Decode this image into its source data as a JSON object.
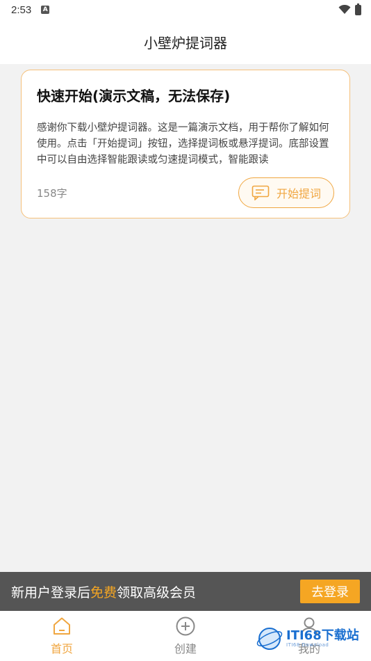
{
  "status_bar": {
    "time": "2:53",
    "notification_icon": "a-badge-icon"
  },
  "app_bar": {
    "title": "小壁炉提词器"
  },
  "script_card": {
    "title": "快速开始(演示文稿，无法保存)",
    "body": "感谢你下载小壁炉提词器。这是一篇演示文档，用于帮你了解如何使用。点击「开始提词」按钮，选择提词板或悬浮提词。底部设置中可以自由选择智能跟读或匀速提词模式，智能跟读",
    "char_count": "158字",
    "start_button_label": "开始提词"
  },
  "login_bar": {
    "promo_prefix": "新用户登录后",
    "promo_highlight": "免费",
    "promo_suffix": "领取高级会员",
    "login_button_label": "去登录"
  },
  "tabs": [
    {
      "label": "首页",
      "icon": "home-icon",
      "active": true
    },
    {
      "label": "创建",
      "icon": "plus-circle-icon",
      "active": false
    },
    {
      "label": "我的",
      "icon": "user-icon",
      "active": false
    }
  ],
  "watermark": {
    "text": "ITI68下载站",
    "sub": "ITI68 Download"
  },
  "colors": {
    "accent": "#f0a640",
    "login_bar_bg": "#555555",
    "login_button_bg": "#f5a623",
    "page_bg": "#f2f2f2"
  }
}
